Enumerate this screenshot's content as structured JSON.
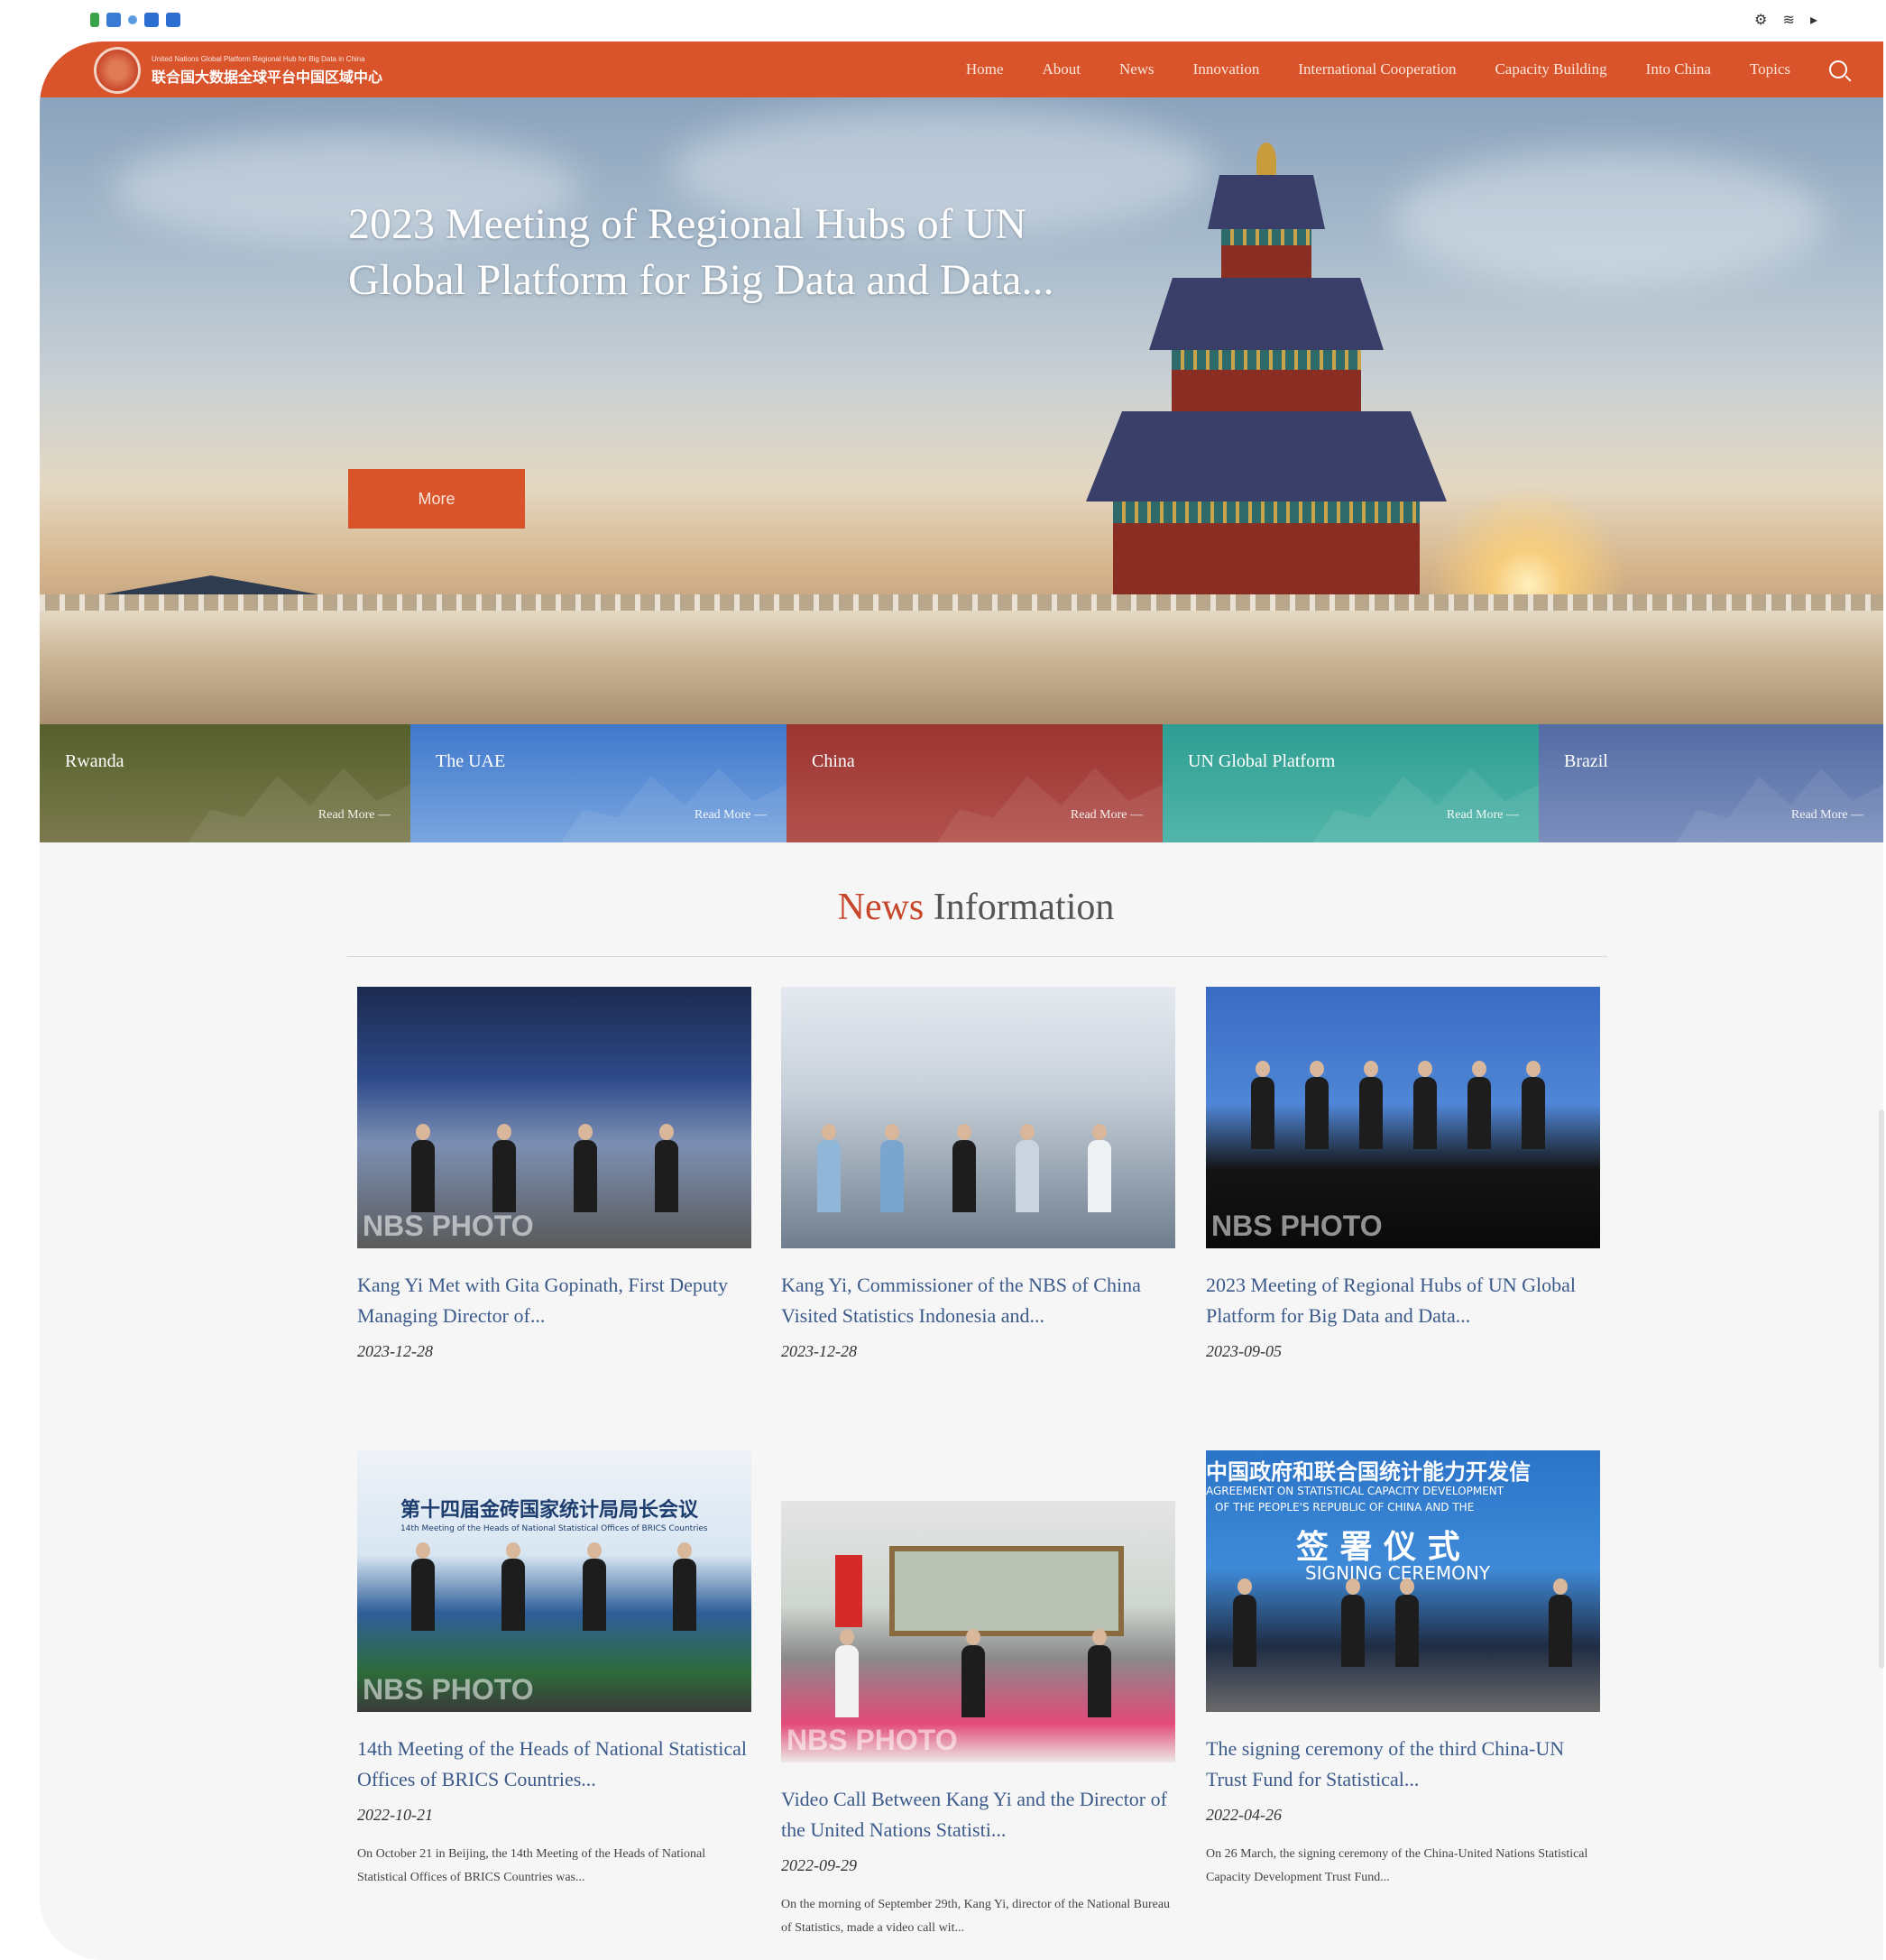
{
  "header": {
    "logo_en": "United Nations Global Platform Regional Hub for Big Data in China",
    "logo_zh": "联合国大数据全球平台中国区域中心",
    "nav": [
      "Home",
      "About",
      "News",
      "Innovation",
      "International Cooperation",
      "Capacity Building",
      "Into China",
      "Topics"
    ]
  },
  "hero": {
    "title": "2023 Meeting of Regional Hubs of UN Global Platform for Big Data and Data...",
    "more_label": "More"
  },
  "tiles": [
    {
      "name": "Rwanda",
      "more": "Read More",
      "color": "#5d6a31"
    },
    {
      "name": "The UAE",
      "more": "Read More",
      "color": "#4f86d1"
    },
    {
      "name": "China",
      "more": "Read More",
      "color": "#a23b37"
    },
    {
      "name": "UN Global Platform",
      "more": "Read More",
      "color": "#3aa79b"
    },
    {
      "name": "Brazil",
      "more": "Read More",
      "color": "#5a73a8"
    }
  ],
  "news": {
    "heading_highlight": "News",
    "heading_rest": " Information",
    "watermark": "NBS PHOTO",
    "items": [
      {
        "title": "Kang Yi Met with Gita Gopinath, First Deputy Managing Director of...",
        "date": "2023-12-28",
        "desc": ""
      },
      {
        "title": "Kang Yi, Commissioner of the NBS of China Visited Statistics Indonesia and...",
        "date": "2023-12-28",
        "desc": ""
      },
      {
        "title": "2023 Meeting of Regional Hubs of UN Global Platform for Big Data and Data...",
        "date": "2023-09-05",
        "desc": ""
      },
      {
        "title": "14th Meeting of the Heads of National Statistical Offices of BRICS Countries...",
        "date": "2022-10-21",
        "desc": "On October 21 in Beijing, the 14th Meeting of the Heads of National Statistical Offices of BRICS Countries was..."
      },
      {
        "title": "Video Call Between Kang Yi and the Director of the United Nations Statisti...",
        "date": "2022-09-29",
        "desc": "On the morning of September 29th, Kang Yi, director of the National Bureau of Statistics, made a video call wit..."
      },
      {
        "title": "The signing ceremony of the third China-UN Trust Fund for Statistical...",
        "date": "2022-04-26",
        "desc": "On 26 March, the signing ceremony of the China-United Nations Statistical Capacity Development Trust Fund..."
      }
    ],
    "photo_text": {
      "brics_zh": "第十四届金砖国家统计局局长会议",
      "brics_en": "14th Meeting of the Heads of National Statistical Offices of BRICS Countries",
      "sign_zh1": "中国政府和联合国统计能力开发信",
      "sign_en1": "AGREEMENT ON STATISTICAL CAPACITY DEVELOPMENT",
      "sign_en2": "OF THE PEOPLE'S REPUBLIC OF CHINA AND THE",
      "sign_zh2": "签 署 仪 式",
      "sign_en3": "SIGNING CEREMONY"
    }
  }
}
